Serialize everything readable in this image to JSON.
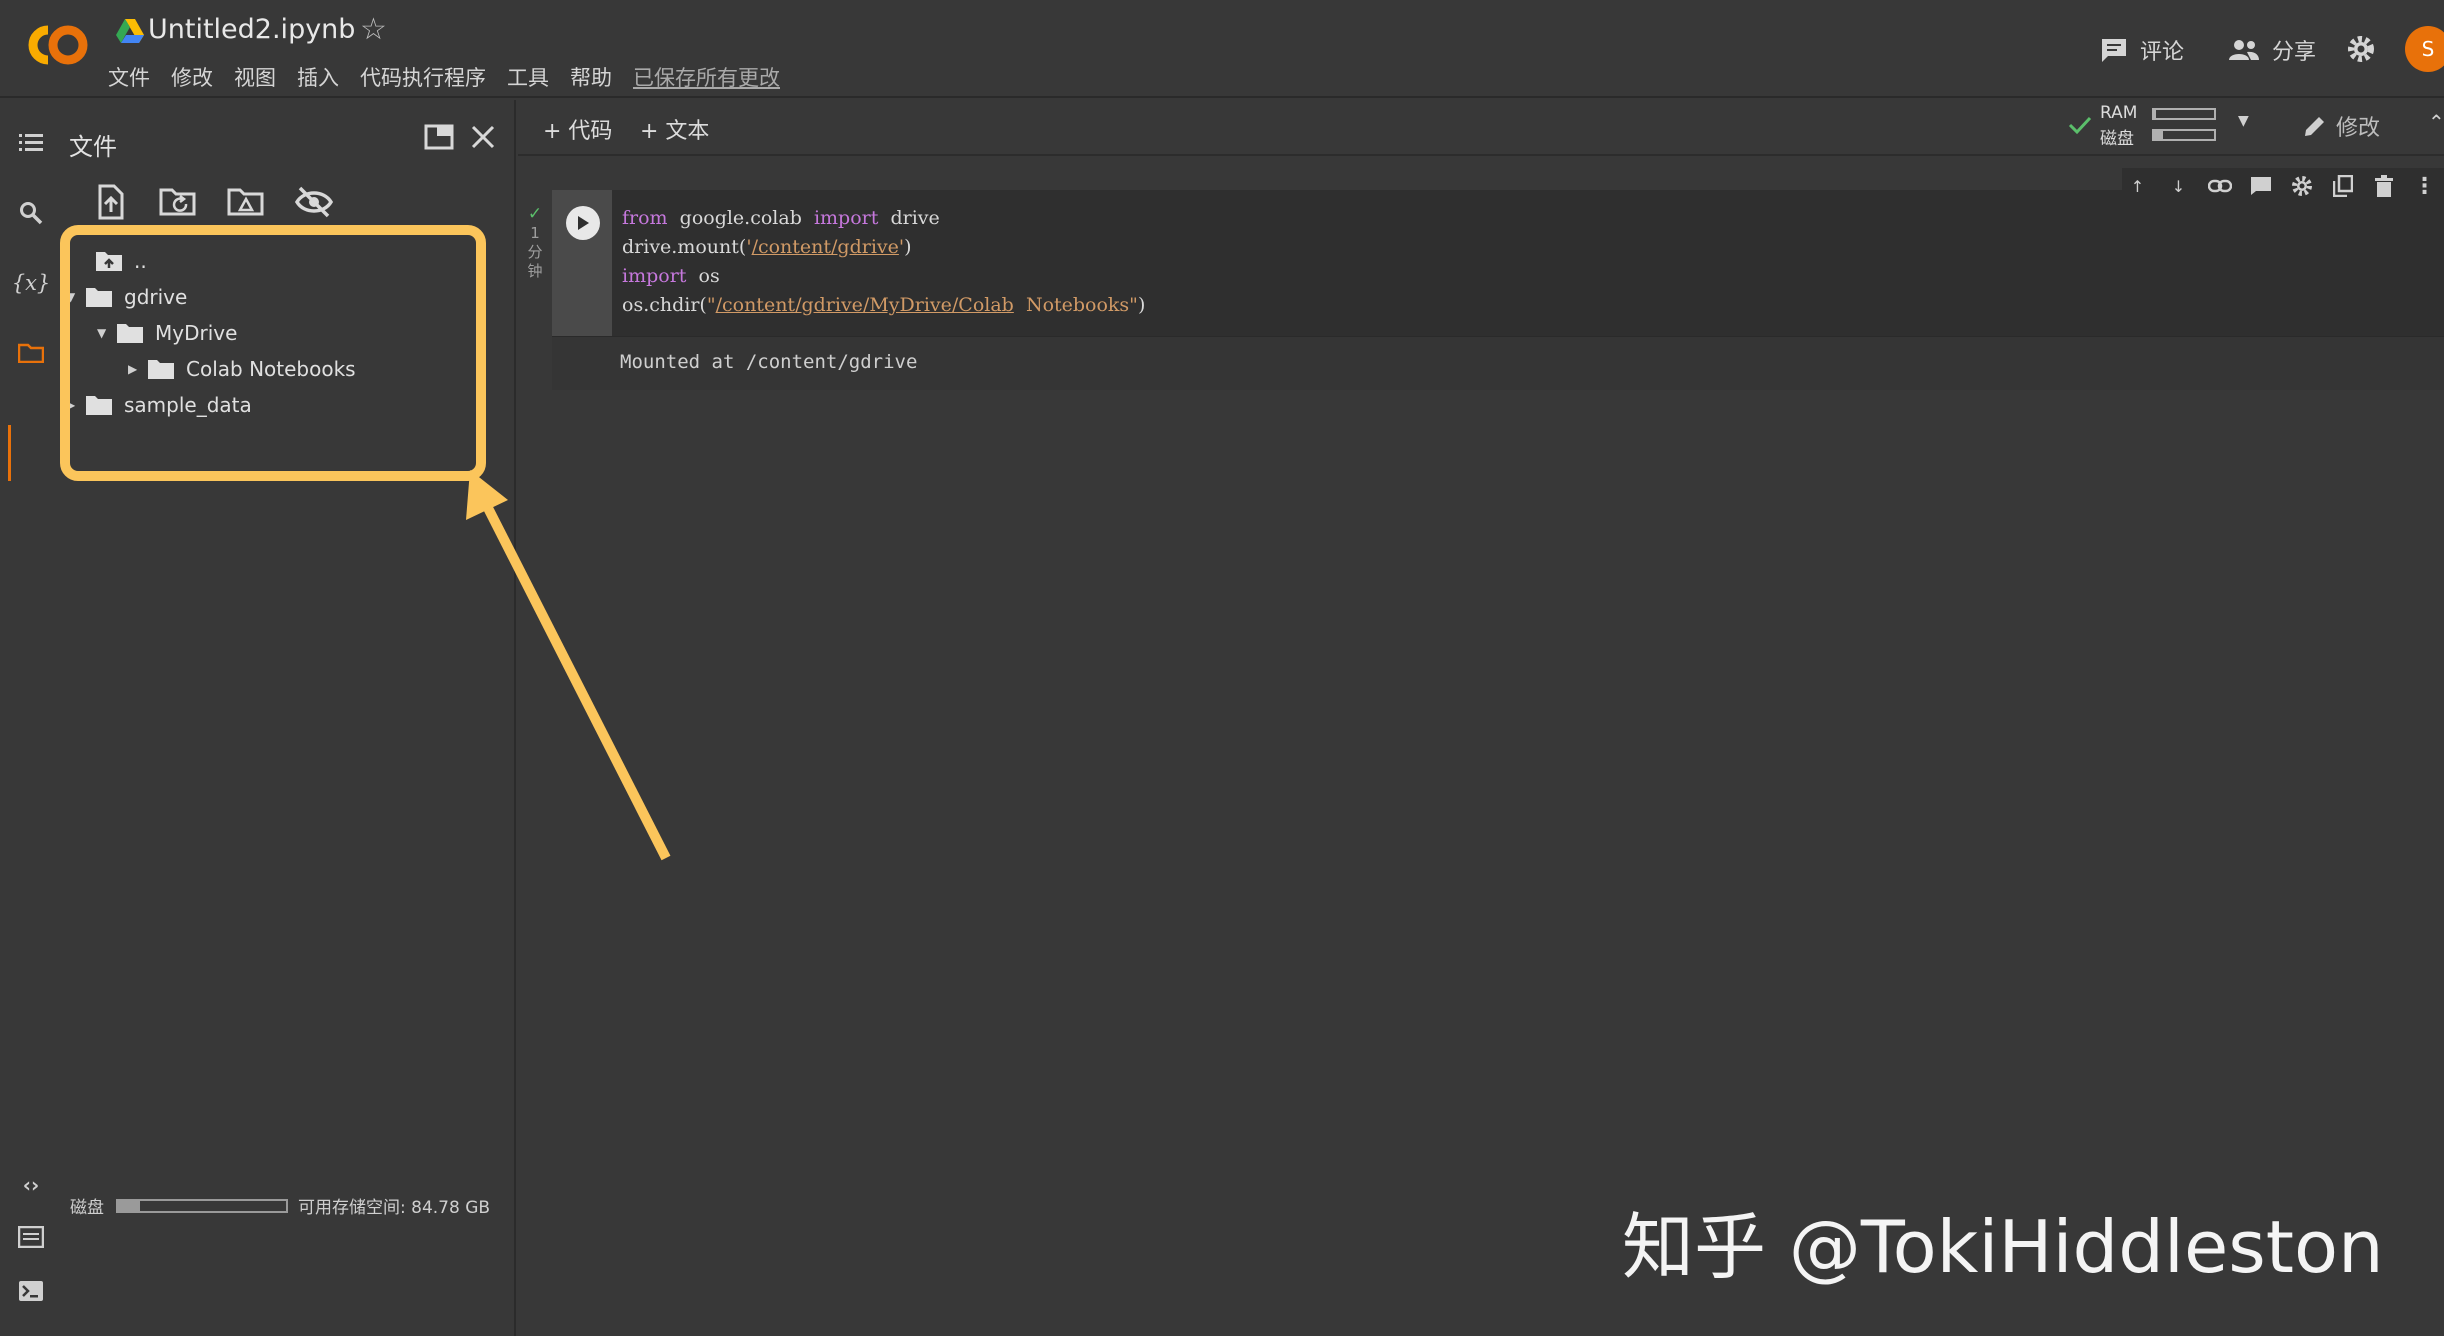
{
  "header": {
    "title": "Untitled2.ipynb",
    "menu": [
      "文件",
      "修改",
      "视图",
      "插入",
      "代码执行程序",
      "工具",
      "帮助"
    ],
    "saved_text": "已保存所有更改",
    "comment_label": "评论",
    "share_label": "分享",
    "avatar_initial": "S",
    "avatar_color": "#e8710a"
  },
  "files_panel": {
    "title": "文件",
    "tree": [
      {
        "label": "..",
        "depth": 0
      },
      {
        "label": "gdrive",
        "depth": 0,
        "expanded": true
      },
      {
        "label": "MyDrive",
        "depth": 1,
        "expanded": true
      },
      {
        "label": "Colab Notebooks",
        "depth": 2,
        "expanded": false
      },
      {
        "label": "sample_data",
        "depth": 0,
        "expanded": false
      }
    ],
    "disk_label": "磁盘",
    "disk_used_fraction": 0.13,
    "available_text": "可用存储空间: 84.78 GB"
  },
  "toolbar": {
    "add_code": "+ 代码",
    "add_text": "+ 文本",
    "ram_label": "RAM",
    "disk_label": "磁盘",
    "ram_fraction": 0.03,
    "disk_fraction": 0.15,
    "edit_label": "修改"
  },
  "cell": {
    "exec_status": "1\n分\n钟",
    "output": "Mounted at /content/gdrive"
  },
  "watermark": "知乎 @TokiHiddleston",
  "accent_color": "#fbc55b"
}
